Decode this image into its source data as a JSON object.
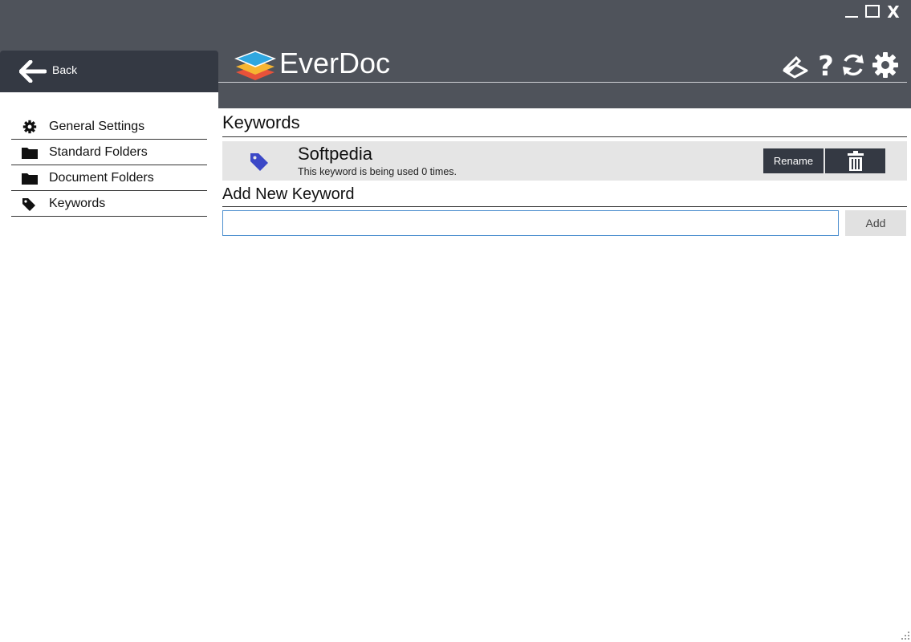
{
  "window": {
    "close_glyph": "X"
  },
  "nav_back": {
    "label": "Back",
    "icon": "arrow-left-icon"
  },
  "app": {
    "title": "EverDoc",
    "logo": "stacked-layers-logo"
  },
  "toolbar": {
    "icons": [
      "scanner-icon",
      "help-icon",
      "sync-icon",
      "settings-gear-icon"
    ],
    "help_glyph": "?"
  },
  "sidebar": {
    "items": [
      {
        "label": "General Settings",
        "icon": "gear-icon"
      },
      {
        "label": "Standard Folders",
        "icon": "folder-icon"
      },
      {
        "label": "Document Folders",
        "icon": "folder-icon"
      },
      {
        "label": "Keywords",
        "icon": "tag-icon"
      }
    ]
  },
  "main": {
    "keywords_title": "Keywords",
    "keywords": [
      {
        "name": "Softpedia",
        "usage": "This keyword is being used 0 times.",
        "icon": "tag-icon"
      }
    ],
    "rename_label": "Rename",
    "add_title": "Add New Keyword",
    "input_value": "",
    "add_label": "Add"
  },
  "colors": {
    "header": "#4f535b",
    "dark_panel": "#343943",
    "tag_accent": "#3b48c7",
    "input_border": "#4d8fcf"
  }
}
